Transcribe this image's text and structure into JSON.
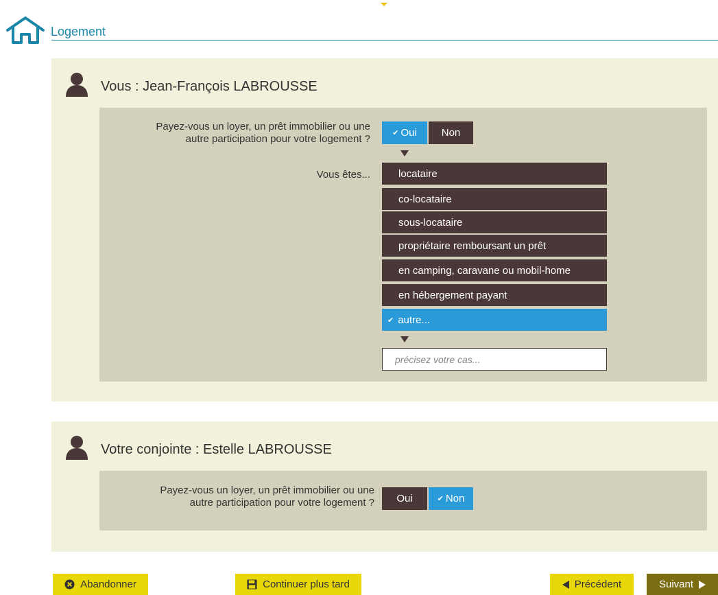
{
  "header": {
    "title": "Logement",
    "icon": "house-icon"
  },
  "persons": [
    {
      "name": "Vous : Jean-François LABROUSSE",
      "question": {
        "line1": "Payez-vous un loyer, un prêt immobilier ou une",
        "line2": "autre participation pour votre logement ?"
      },
      "yes_label": "Oui",
      "no_label": "Non",
      "selected": "Oui",
      "status_label": "Vous êtes...",
      "options": [
        "locataire",
        "co-locataire",
        "sous-locataire",
        "propriétaire remboursant un prêt",
        "en camping, caravane ou mobil-home",
        "en hébergement payant",
        "autre..."
      ],
      "selected_option": "autre...",
      "detail_placeholder": "précisez votre cas...",
      "detail_value": ""
    },
    {
      "name": "Votre conjointe : Estelle LABROUSSE",
      "question": {
        "line1": "Payez-vous un loyer, un prêt immobilier ou une",
        "line2": "autre participation pour votre logement ?"
      },
      "yes_label": "Oui",
      "no_label": "Non",
      "selected": "Non"
    }
  ],
  "footer": {
    "abandon": "Abandonner",
    "later": "Continuer plus tard",
    "previous": "Précédent",
    "next": "Suivant"
  },
  "colors": {
    "accent": "#2a9bd8",
    "dark": "#4a3838",
    "panel": "#f2f2dc",
    "inner": "#d3d1bc",
    "header": "#1b87a8",
    "button": "#e8d80a",
    "next_button": "#7a6d12"
  }
}
